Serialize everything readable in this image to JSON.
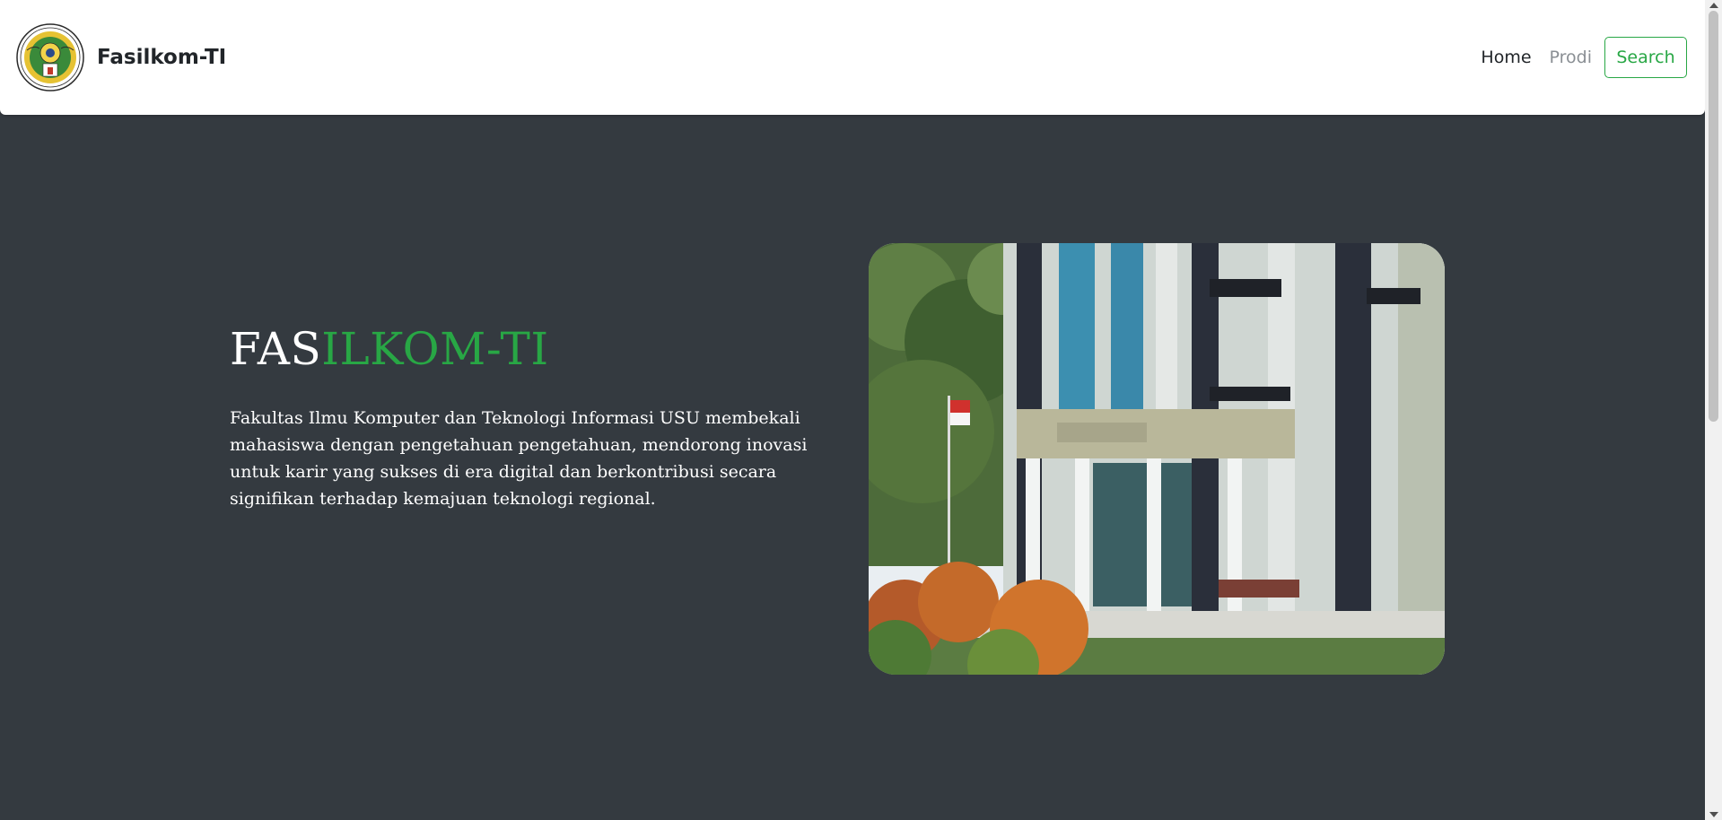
{
  "navbar": {
    "brand_name": "Fasilkom-TI",
    "logo_icon": "university-seal-logo",
    "links": [
      {
        "label": "Home"
      },
      {
        "label": "Prodi"
      }
    ],
    "search_button_label": "Search"
  },
  "hero": {
    "title_part1": "FAS",
    "title_part2": "ILKOM-TI",
    "description": "Fakultas Ilmu Komputer dan Teknologi Informasi USU membekali mahasiswa dengan pengetahuan pengetahuan, mendorong inovasi untuk karir yang sukses di era digital dan berkontribusi secara signifikan terhadap kemajuan teknologi regional.",
    "image_subject": "faculty-building-photo"
  },
  "colors": {
    "accent": "#28a745",
    "background": "#343a40",
    "navbar": "#ffffff"
  }
}
